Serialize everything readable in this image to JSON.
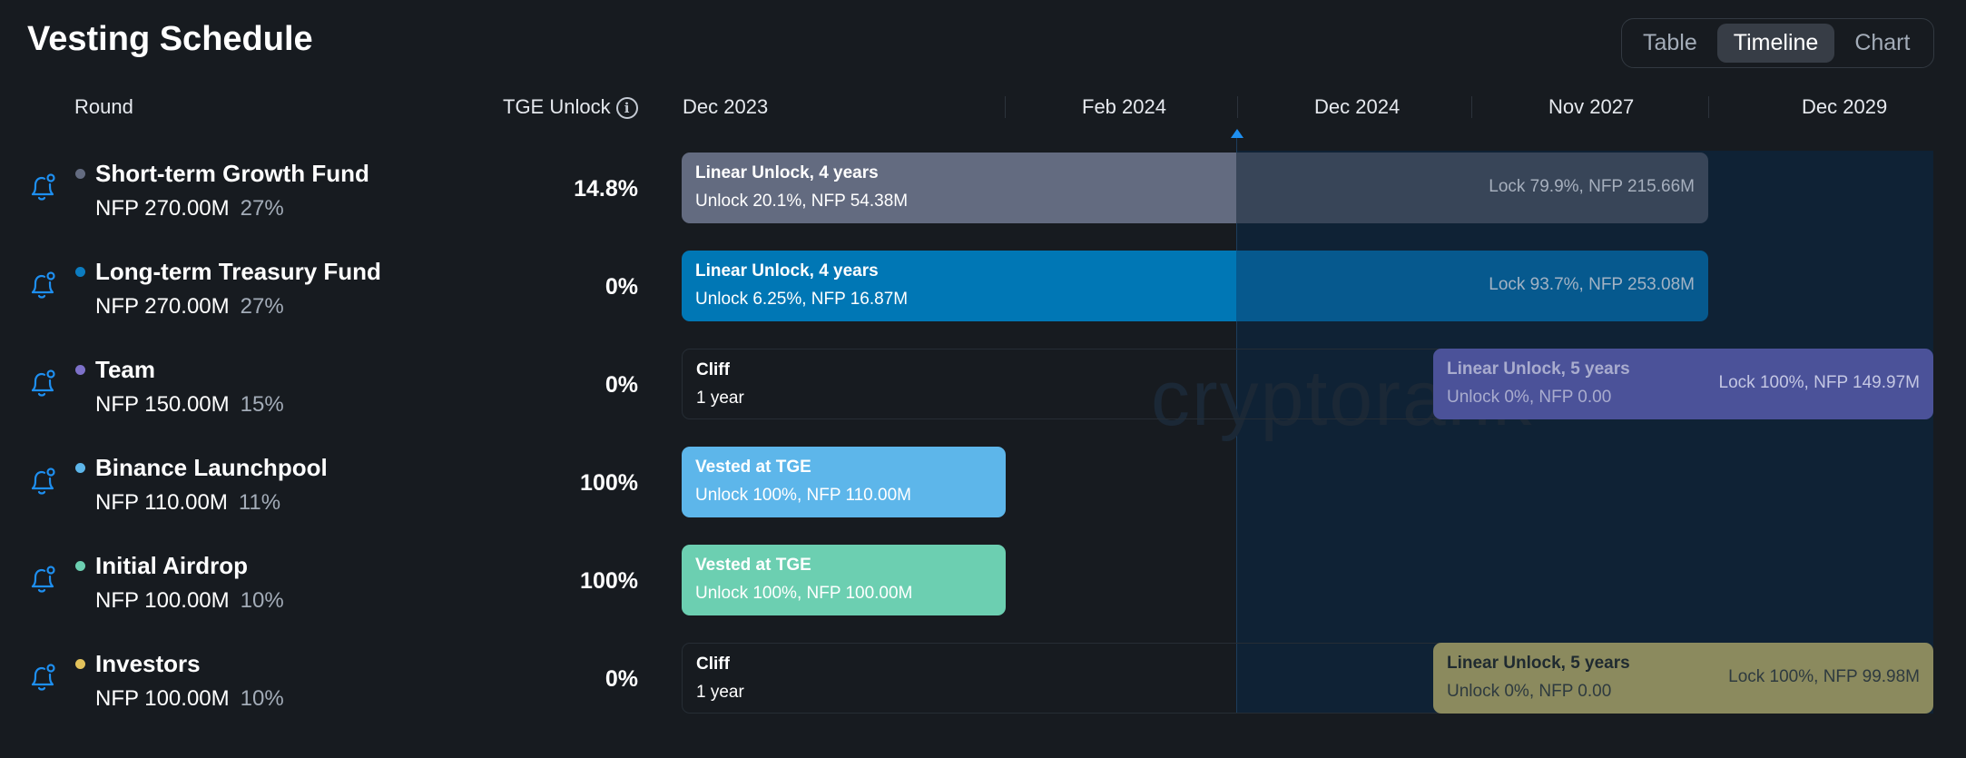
{
  "header": {
    "title": "Vesting Schedule",
    "view_tabs": [
      "Table",
      "Timeline",
      "Chart"
    ],
    "active_tab": "Timeline"
  },
  "columns": {
    "round": "Round",
    "tge_unlock": "TGE Unlock"
  },
  "timeline": {
    "axis_labels": [
      "Dec 2023",
      "Feb 2024",
      "Dec 2024",
      "Nov 2027",
      "Dec 2029"
    ],
    "watermark": "cryptorank"
  },
  "colors": {
    "background": "#171b20",
    "future_zone": "#0f2235",
    "accent": "#1e8ff0"
  },
  "rounds": [
    {
      "name": "Short-term Growth Fund",
      "amount": "NFP 270.00M",
      "share": "27%",
      "dot_color": "#636b80",
      "tge": "14.8%",
      "bar": {
        "title": "Linear Unlock, 4 years",
        "sub": "Unlock 20.1%, NFP 54.38M",
        "right": "Lock 79.9%, NFP 215.66M",
        "color_unlocked": "#636b80",
        "color_locked": "#384558"
      }
    },
    {
      "name": "Long-term Treasury Fund",
      "amount": "NFP 270.00M",
      "share": "27%",
      "dot_color": "#0c7cc0",
      "tge": "0%",
      "bar": {
        "title": "Linear Unlock, 4 years",
        "sub": "Unlock 6.25%, NFP 16.87M",
        "right": "Lock 93.7%, NFP 253.08M",
        "color_unlocked": "#0077b5",
        "color_locked": "#06598e"
      }
    },
    {
      "name": "Team",
      "amount": "NFP 150.00M",
      "share": "15%",
      "dot_color": "#7d71c9",
      "tge": "0%",
      "cliff": {
        "title": "Cliff",
        "sub": "1 year"
      },
      "bar": {
        "title": "Linear Unlock, 5 years",
        "sub": "Unlock 0%, NFP 0.00",
        "right": "Lock 100%, NFP 149.97M",
        "color_locked": "#4b5299"
      }
    },
    {
      "name": "Binance Launchpool",
      "amount": "NFP 110.00M",
      "share": "11%",
      "dot_color": "#5db6ea",
      "tge": "100%",
      "bar": {
        "title": "Vested at TGE",
        "sub": "Unlock 100%, NFP 110.00M",
        "color_unlocked": "#5db6ea"
      }
    },
    {
      "name": "Initial Airdrop",
      "amount": "NFP 100.00M",
      "share": "10%",
      "dot_color": "#6ccfb1",
      "tge": "100%",
      "bar": {
        "title": "Vested at TGE",
        "sub": "Unlock 100%, NFP 100.00M",
        "color_unlocked": "#6ccfb1"
      }
    },
    {
      "name": "Investors",
      "amount": "NFP 100.00M",
      "share": "10%",
      "dot_color": "#e2c25b",
      "tge": "0%",
      "cliff": {
        "title": "Cliff",
        "sub": "1 year"
      },
      "bar": {
        "title": "Linear Unlock, 5 years",
        "sub": "Unlock 0%, NFP 0.00",
        "right": "Lock 100%, NFP 99.98M",
        "color_locked": "#8b8a5e"
      }
    }
  ]
}
